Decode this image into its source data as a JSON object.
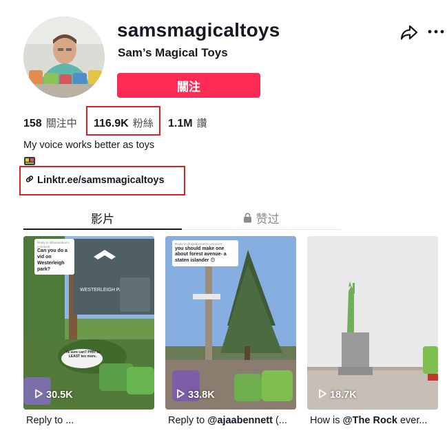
{
  "profile": {
    "username": "samsmagicaltoys",
    "display_name": "Sam’s Magical Toys",
    "follow_label": "關注",
    "bio": "My voice works better as toys",
    "link": "Linktr.ee/samsmagicaltoys"
  },
  "stats": {
    "following_count": "158",
    "following_label": "關注中",
    "followers_count": "116.9K",
    "followers_label": "粉絲",
    "likes_count": "1.1M",
    "likes_label": "讚"
  },
  "tabs": {
    "videos": "影片",
    "liked": "赞过"
  },
  "videos": [
    {
      "views": "30.5K",
      "caption": "Reply to ...",
      "comment": "Can you do a vid on Westerleigh park?",
      "comment_header": "Reply to @bonnieboo's comment",
      "sign_text": "WESTERLEIGH PARK",
      "speech": "Ya sure can? Pffft! at LEAST ten more."
    },
    {
      "views": "33.8K",
      "caption_prefix": "Reply to ",
      "caption_mention": "@ajaabennett",
      "caption_suffix": " (...",
      "comment": "you should make one about forest avenue- a staten islander 😊",
      "comment_header": "Reply to @ajaabennett's comment"
    },
    {
      "views": "18.7K",
      "caption_prefix": "How is ",
      "caption_mention": "@The Rock",
      "caption_suffix": " ever..."
    }
  ],
  "colors": {
    "accent": "#fe2c55",
    "highlight_box": "#e11d1d",
    "text_primary": "#161823",
    "text_secondary": "#8a8b91"
  },
  "icons": [
    "share-icon",
    "more-icon",
    "link-icon",
    "lock-icon",
    "play-icon"
  ]
}
